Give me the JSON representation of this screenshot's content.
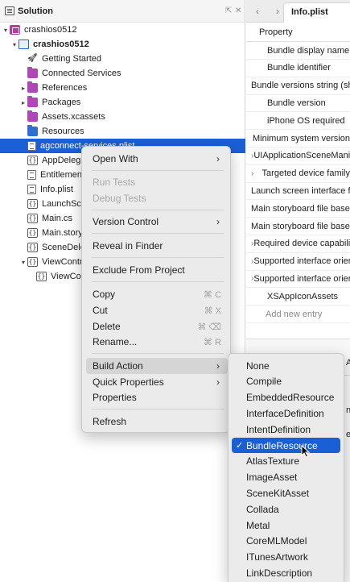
{
  "solution_pane": {
    "title": "Solution",
    "pin_glyph": "⇱",
    "close_glyph": "✕",
    "items": [
      {
        "label": "crashios0512",
        "icon": "solution-icon",
        "disclosure": "▾",
        "indent": 0,
        "bold": false
      },
      {
        "label": "crashios0512",
        "icon": "project-icon",
        "disclosure": "▾",
        "indent": 1,
        "bold": true
      },
      {
        "label": "Getting Started",
        "icon": "rocket-icon",
        "disclosure": "",
        "indent": 2,
        "bold": false
      },
      {
        "label": "Connected Services",
        "icon": "services-icon",
        "disclosure": "",
        "indent": 2,
        "bold": false
      },
      {
        "label": "References",
        "icon": "folder-icon",
        "disclosure": "▸",
        "indent": 2,
        "bold": false
      },
      {
        "label": "Packages",
        "icon": "folder-icon",
        "disclosure": "▸",
        "indent": 2,
        "bold": false
      },
      {
        "label": "Assets.xcassets",
        "icon": "folder-icon",
        "disclosure": "",
        "indent": 2,
        "bold": false
      },
      {
        "label": "Resources",
        "icon": "blue-folder-icon",
        "disclosure": "",
        "indent": 2,
        "bold": false
      },
      {
        "label": "agconnect-services.plist",
        "icon": "plist-file-icon",
        "disclosure": "",
        "indent": 2,
        "bold": false,
        "selected": true
      },
      {
        "label": "AppDelegate.cs",
        "icon": "code-file-icon",
        "disclosure": "",
        "indent": 2,
        "bold": false
      },
      {
        "label": "Entitlements.plist",
        "icon": "plist-file-icon",
        "disclosure": "",
        "indent": 2,
        "bold": false
      },
      {
        "label": "Info.plist",
        "icon": "plist-file-icon",
        "disclosure": "",
        "indent": 2,
        "bold": false
      },
      {
        "label": "LaunchScreen.storyboard",
        "icon": "code-file-icon",
        "disclosure": "",
        "indent": 2,
        "bold": false
      },
      {
        "label": "Main.cs",
        "icon": "code-file-icon",
        "disclosure": "",
        "indent": 2,
        "bold": false
      },
      {
        "label": "Main.storyboard",
        "icon": "code-file-icon",
        "disclosure": "",
        "indent": 2,
        "bold": false
      },
      {
        "label": "SceneDelegate.cs",
        "icon": "code-file-icon",
        "disclosure": "",
        "indent": 2,
        "bold": false
      },
      {
        "label": "ViewController.cs",
        "icon": "code-file-icon",
        "disclosure": "▾",
        "indent": 2,
        "bold": false
      },
      {
        "label": "ViewController.designer.cs",
        "icon": "code-file-icon",
        "disclosure": "",
        "indent": 3,
        "bold": false
      }
    ]
  },
  "editor": {
    "back_glyph": "‹",
    "forward_glyph": "›",
    "tab_title": "Info.plist",
    "column_header": "Property",
    "properties": [
      {
        "label": "Bundle display name",
        "expandable": false
      },
      {
        "label": "Bundle identifier",
        "expandable": false
      },
      {
        "label": "Bundle versions string (short)",
        "expandable": false
      },
      {
        "label": "Bundle version",
        "expandable": false
      },
      {
        "label": "iPhone OS required",
        "expandable": false
      },
      {
        "label": "Minimum system version",
        "expandable": false
      },
      {
        "label": "UIApplicationSceneManifest",
        "expandable": true
      },
      {
        "label": "Targeted device family",
        "expandable": true
      },
      {
        "label": "Launch screen interface file base name",
        "expandable": false
      },
      {
        "label": "Main storyboard file base name",
        "expandable": false
      },
      {
        "label": "Main storyboard file base name (iPad)",
        "expandable": false
      },
      {
        "label": "Required device capabilities",
        "expandable": true
      },
      {
        "label": "Supported interface orientations",
        "expandable": true
      },
      {
        "label": "Supported interface orientations (iPad)",
        "expandable": true
      },
      {
        "label": "XSAppIconAssets",
        "expandable": false
      }
    ],
    "add_entry": "Add new entry",
    "lower_bar_fragment": "A",
    "lower_mid_fragment_1": "ni",
    "lower_mid_fragment_2": "es"
  },
  "context_menu": {
    "items": [
      {
        "label": "Open With",
        "type": "submenu"
      },
      {
        "type": "separator"
      },
      {
        "label": "Run Tests",
        "type": "disabled"
      },
      {
        "label": "Debug Tests",
        "type": "disabled"
      },
      {
        "type": "separator"
      },
      {
        "label": "Version Control",
        "type": "submenu"
      },
      {
        "type": "separator"
      },
      {
        "label": "Reveal in Finder",
        "type": "item"
      },
      {
        "type": "separator"
      },
      {
        "label": "Exclude From Project",
        "type": "item"
      },
      {
        "type": "separator"
      },
      {
        "label": "Copy",
        "type": "item",
        "shortcut": "⌘ C"
      },
      {
        "label": "Cut",
        "type": "item",
        "shortcut": "⌘ X"
      },
      {
        "label": "Delete",
        "type": "item",
        "shortcut": "⌘ ⌫"
      },
      {
        "label": "Rename...",
        "type": "item",
        "shortcut": "⌘ R"
      },
      {
        "type": "separator"
      },
      {
        "label": "Build Action",
        "type": "submenu",
        "active": true
      },
      {
        "label": "Quick Properties",
        "type": "submenu"
      },
      {
        "label": "Properties",
        "type": "item"
      },
      {
        "type": "separator"
      },
      {
        "label": "Refresh",
        "type": "item"
      }
    ]
  },
  "build_action_submenu": {
    "check_glyph": "✓",
    "items": [
      {
        "label": "None",
        "checked": false
      },
      {
        "label": "Compile",
        "checked": false
      },
      {
        "label": "EmbeddedResource",
        "checked": false
      },
      {
        "label": "InterfaceDefinition",
        "checked": false
      },
      {
        "label": "IntentDefinition",
        "checked": false
      },
      {
        "label": "BundleResource",
        "checked": true
      },
      {
        "label": "AtlasTexture",
        "checked": false
      },
      {
        "label": "ImageAsset",
        "checked": false
      },
      {
        "label": "SceneKitAsset",
        "checked": false
      },
      {
        "label": "Collada",
        "checked": false
      },
      {
        "label": "Metal",
        "checked": false
      },
      {
        "label": "CoreMLModel",
        "checked": false
      },
      {
        "label": "ITunesArtwork",
        "checked": false
      },
      {
        "label": "LinkDescription",
        "checked": false
      }
    ]
  },
  "colors": {
    "selection": "#1b5fd6",
    "menu_bg": "#ebebeb",
    "solution_icon": "#b43ca0",
    "folder_purple": "#b146b6",
    "folder_blue": "#2f6fd3"
  }
}
